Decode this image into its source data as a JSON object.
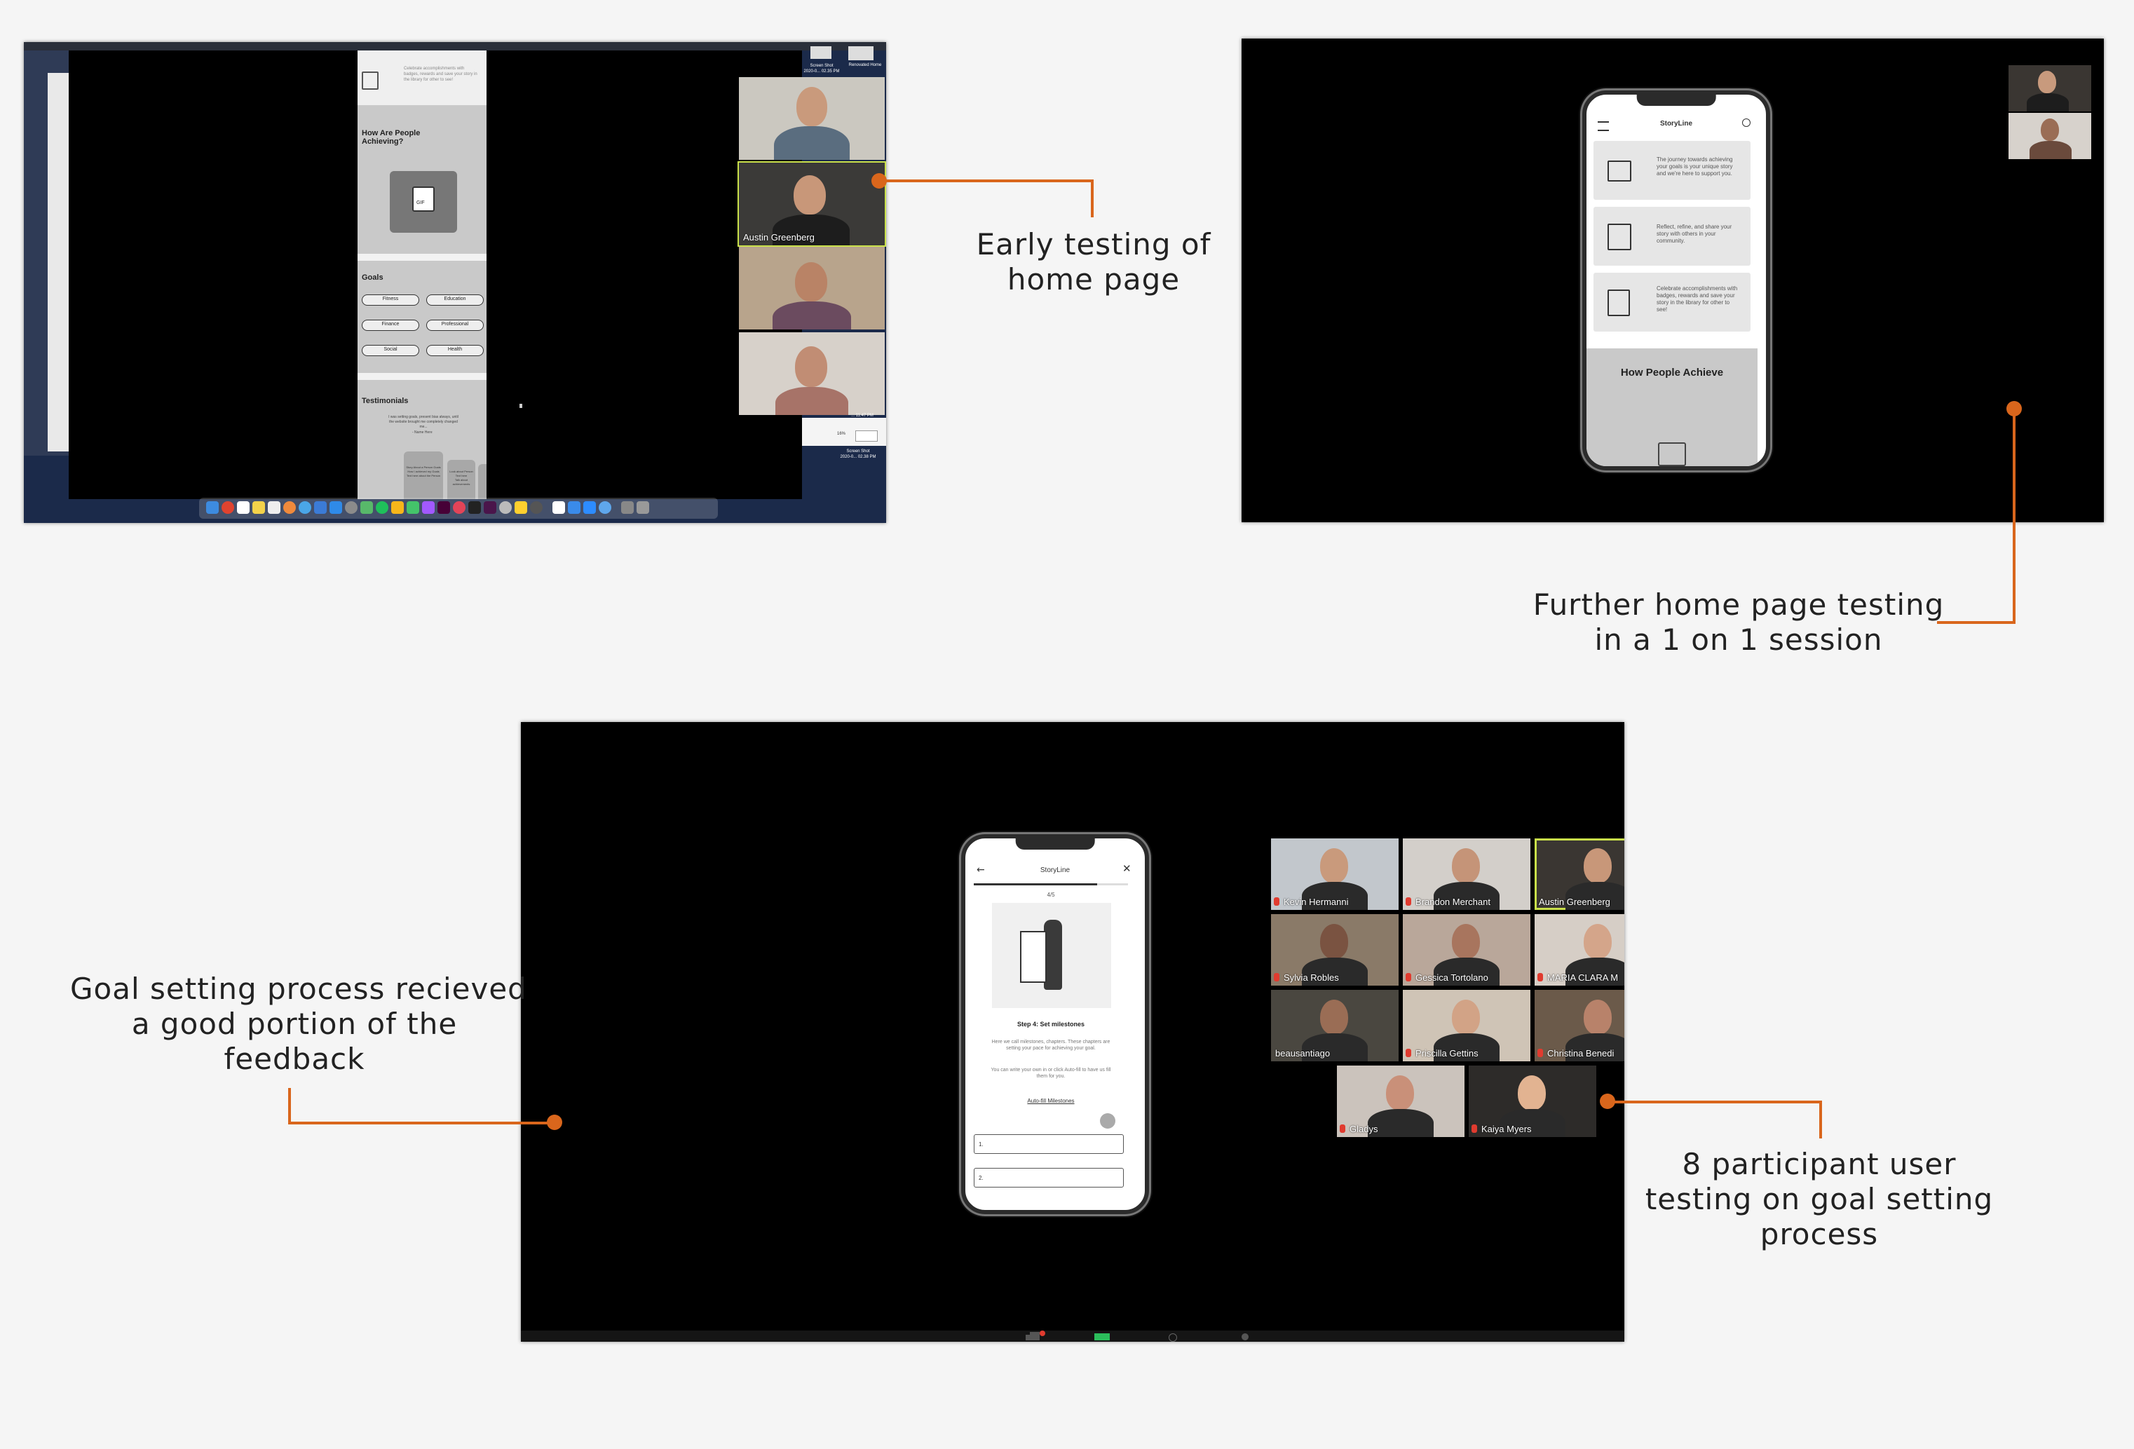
{
  "captions": {
    "early": "Early testing of\nhome page",
    "further": "Further home page testing\nin a 1 on 1 session",
    "goal_feedback": "Goal setting process recieved\na good portion of the\nfeedback",
    "participants": "8 participant user\ntesting on goal setting\nprocess"
  },
  "shot1": {
    "top_right_lines": [
      "Screen Shot",
      "2020-0... 02.35 PM"
    ],
    "top_right_right": "Renovated Home",
    "bottom_right_lines": [
      "Screen Shot",
      "2020-0... 02.38 PM"
    ],
    "bottom_time": "... 11.47 PM",
    "bottom_badge": "16%",
    "wire": {
      "intro": "Celebrate accomplishments with badges, rewards and save your story in the library for other to see!",
      "how_title": "How Are People\nAchieving?",
      "gif_label": "GIF",
      "goals_title": "Goals",
      "goal_pills": [
        "Fitness",
        "Education",
        "Finance",
        "Professional",
        "Social",
        "Health"
      ],
      "testimonials_title": "Testimonials",
      "testimonial_text": "I was setting goals, present bias always, until the website brought me completely changed me...",
      "testimonial_author": "- Name Here",
      "card1": "Story About a Person Goals\nHow I achieved my Goals\nText here about the Person",
      "card2": "Look about Person\nText here\nTalk about achievements"
    },
    "participants": [
      {
        "name": ""
      },
      {
        "name": "Austin Greenberg"
      },
      {
        "name": ""
      },
      {
        "name": ""
      }
    ]
  },
  "shot2": {
    "app_title": "StoryLine",
    "cards": [
      "The journey towards achieving your goals is your unique story and we're here to support you.",
      "Reflect, refine, and share your story with others in your community.",
      "Celebrate accomplishments with badges, rewards and save your story in the library for other to see!"
    ],
    "section_title": "How People Achieve"
  },
  "shot3": {
    "app_title": "StoryLine",
    "progress": "4/5",
    "step_title": "Step 4: Set milestones",
    "desc1": "Here we call milestones, chapters. These chapters are setting your pace for achieving your goal.",
    "desc2": "You can write your own in or click Auto-fill to have us fill them for you.",
    "autofill": "Auto-fill Milestones",
    "fields": [
      "1.",
      "2."
    ],
    "participants": [
      {
        "name": "Kevin Hermanni",
        "muted": true
      },
      {
        "name": "Brandon Merchant",
        "muted": true
      },
      {
        "name": "Austin Greenberg",
        "muted": false
      },
      {
        "name": "Sylvia Robles",
        "muted": true
      },
      {
        "name": "Gessica Tortolano",
        "muted": true
      },
      {
        "name": "MARIA CLARA M",
        "muted": true
      },
      {
        "name": "beausantiago",
        "muted": false
      },
      {
        "name": "Priscilla Gettins",
        "muted": true
      },
      {
        "name": "Christina Benedi",
        "muted": true
      },
      {
        "name": "Gladys",
        "muted": true
      },
      {
        "name": "Kaiya Myers",
        "muted": true
      }
    ]
  },
  "colors": {
    "accent": "#d9661c",
    "background": "#f5f5f5",
    "speaker_highlight": "#c9e04a"
  }
}
